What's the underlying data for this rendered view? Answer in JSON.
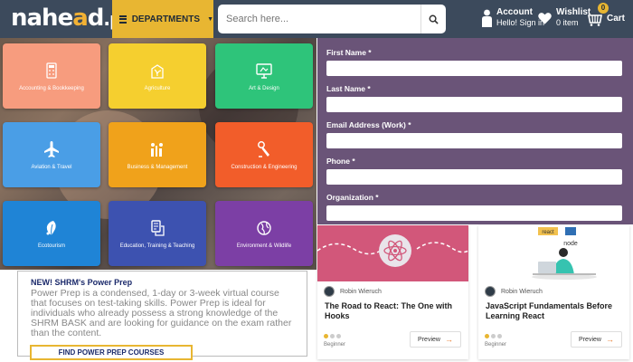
{
  "header": {
    "logo": {
      "main": "nahe",
      "accent": "a",
      "end": "d",
      "tld": ".pk"
    },
    "departments_label": "DEPARTMENTS",
    "search_placeholder": "Search here...",
    "account": {
      "title": "Account",
      "subtitle": "Hello! Sign in"
    },
    "wishlist": {
      "title": "Wishlist",
      "subtitle": "0 item"
    },
    "cart": {
      "label": "Cart",
      "count": "0"
    }
  },
  "categories": [
    {
      "label": "Accounting & Bookkeeping",
      "color": "#f79c7e",
      "icon": "calculator-icon"
    },
    {
      "label": "Agriculture",
      "color": "#f5cf2f",
      "icon": "plant-icon"
    },
    {
      "label": "Art & Design",
      "color": "#2ec47a",
      "icon": "monitor-icon"
    },
    {
      "label": "Aviation & Travel",
      "color": "#4a9ee6",
      "icon": "airplane-icon"
    },
    {
      "label": "Business & Management",
      "color": "#f0a21b",
      "icon": "chart-icon"
    },
    {
      "label": "Construction & Engineering",
      "color": "#f25d2a",
      "icon": "tools-icon"
    },
    {
      "label": "Ecotourism",
      "color": "#1f84d6",
      "icon": "leaf-icon"
    },
    {
      "label": "Education, Training & Teaching",
      "color": "#3d52b0",
      "icon": "book-icon"
    },
    {
      "label": "Environment & Wildlife",
      "color": "#7c3fa5",
      "icon": "globe-icon"
    }
  ],
  "form": {
    "fields": [
      {
        "label": "First Name *"
      },
      {
        "label": "Last Name *"
      },
      {
        "label": "Email Address (Work) *"
      },
      {
        "label": "Phone *"
      },
      {
        "label": "Organization *"
      }
    ]
  },
  "promo": {
    "new_tag": "NEW!",
    "title": "SHRM's Power Prep",
    "body": "Power Prep is a condensed, 1-day or 3-week virtual course that focuses on test-taking skills. Power Prep is ideal for individuals who already possess a strong knowledge of the SHRM BASK and are looking for guidance on the exam rather than the content.",
    "button": "FIND POWER PREP COURSES"
  },
  "courses": [
    {
      "author": "Robin Wieruch",
      "title": "The Road to React: The One with Hooks",
      "level": "Beginner",
      "preview": "Preview",
      "level_value": 1,
      "level_max": 3
    },
    {
      "author": "Robin Wieruch",
      "title": "JavaScript Fundamentals Before Learning React",
      "level": "Beginner",
      "preview": "Preview",
      "level_value": 1,
      "level_max": 3,
      "thumb_badges": [
        "react",
        "node"
      ]
    }
  ]
}
